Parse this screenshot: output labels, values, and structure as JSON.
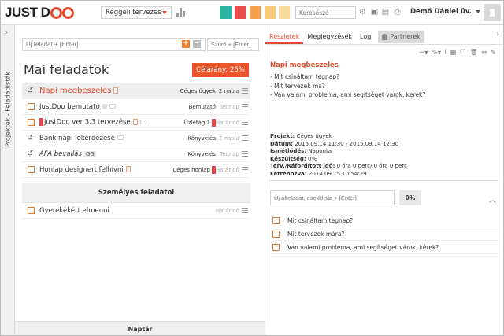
{
  "app": {
    "logo_left": "JUST D",
    "logo_right": ""
  },
  "topbar": {
    "view_select": "Reggeli tervezés",
    "search_placeholder": "Keresőszó",
    "user_name": "Demó Dániel üv.",
    "swatches": [
      "#2bb3a3",
      "#e74c4c",
      "#f3a14d",
      "#fbc97a",
      "#fbd99b"
    ]
  },
  "left_strip": {
    "label": "Projektek  -  Feladatlisták"
  },
  "tasks_panel": {
    "new_task_placeholder": "Új feladat + [Enter]",
    "filter_placeholder": "Szűrő + [Enter]",
    "title": "Mai feladatok",
    "target_label": "Célarány: 25%",
    "tasks": [
      {
        "title": "Napi megbeszeles",
        "project": "Céges ügyek",
        "due": "2 napja",
        "recurring": true
      },
      {
        "title": "JustDoo bemutató",
        "project": "Bemutató",
        "due": "Teqnap",
        "recurring": false
      },
      {
        "title": "JustDoo ver 3.3 tervezése",
        "project": "Üzletág 1",
        "due": "Határidő",
        "recurring": false
      },
      {
        "title": "Bank napi lekerdezese",
        "project": "Könyvelés",
        "due": "2 napja",
        "recurring": true
      },
      {
        "title": "ÁFA bevallás",
        "tag": "GG",
        "project": "Könyvelés",
        "due": "Teqnap",
        "recurring": true
      },
      {
        "title": "Honlap designert felhívni",
        "project": "Céges honlap",
        "due": "Határidő",
        "recurring": false
      }
    ],
    "personal_section": "Személyes feladatol",
    "personal_tasks": [
      {
        "title": "Gyerekekért elmenni",
        "project": "",
        "due": "Határidő"
      }
    ]
  },
  "bottom_bar": {
    "label": "Naptár"
  },
  "detail": {
    "tabs": [
      "Részletek",
      "Megjegyzések",
      "Log"
    ],
    "partner_tab": "Partnerek",
    "title": "Napi megbeszeles",
    "description": [
      "- Mit csináltam tegnap?",
      "- Mit tervezek ma?",
      "- Van valami problema, ami segítséget varok, kerek?"
    ],
    "meta": [
      {
        "label": "Projekt:",
        "value": "Céges ügyek"
      },
      {
        "label": "Dátum:",
        "value": "2015.09.14 11:30 - 2015.09.14 12:30"
      },
      {
        "label": "Ismétlődés:",
        "value": "Naponta"
      },
      {
        "label": "Készültség:",
        "value": "0%"
      },
      {
        "label": "Terv./Ráfordított idő:",
        "value": "0 óra 0 perc/ 0 óra 0 perc"
      },
      {
        "label": "Létrehozva:",
        "value": "2014.09.15 10:54:29"
      }
    ],
    "subtask_placeholder": "Új alfeladat, csekklista + [Enter]",
    "subtask_pct": "0%",
    "subtasks": [
      "Mit csináltam tegnap?",
      "Mit tervezek mára?",
      "Van valami probléma, ami segítséget várok, kérek?"
    ]
  }
}
